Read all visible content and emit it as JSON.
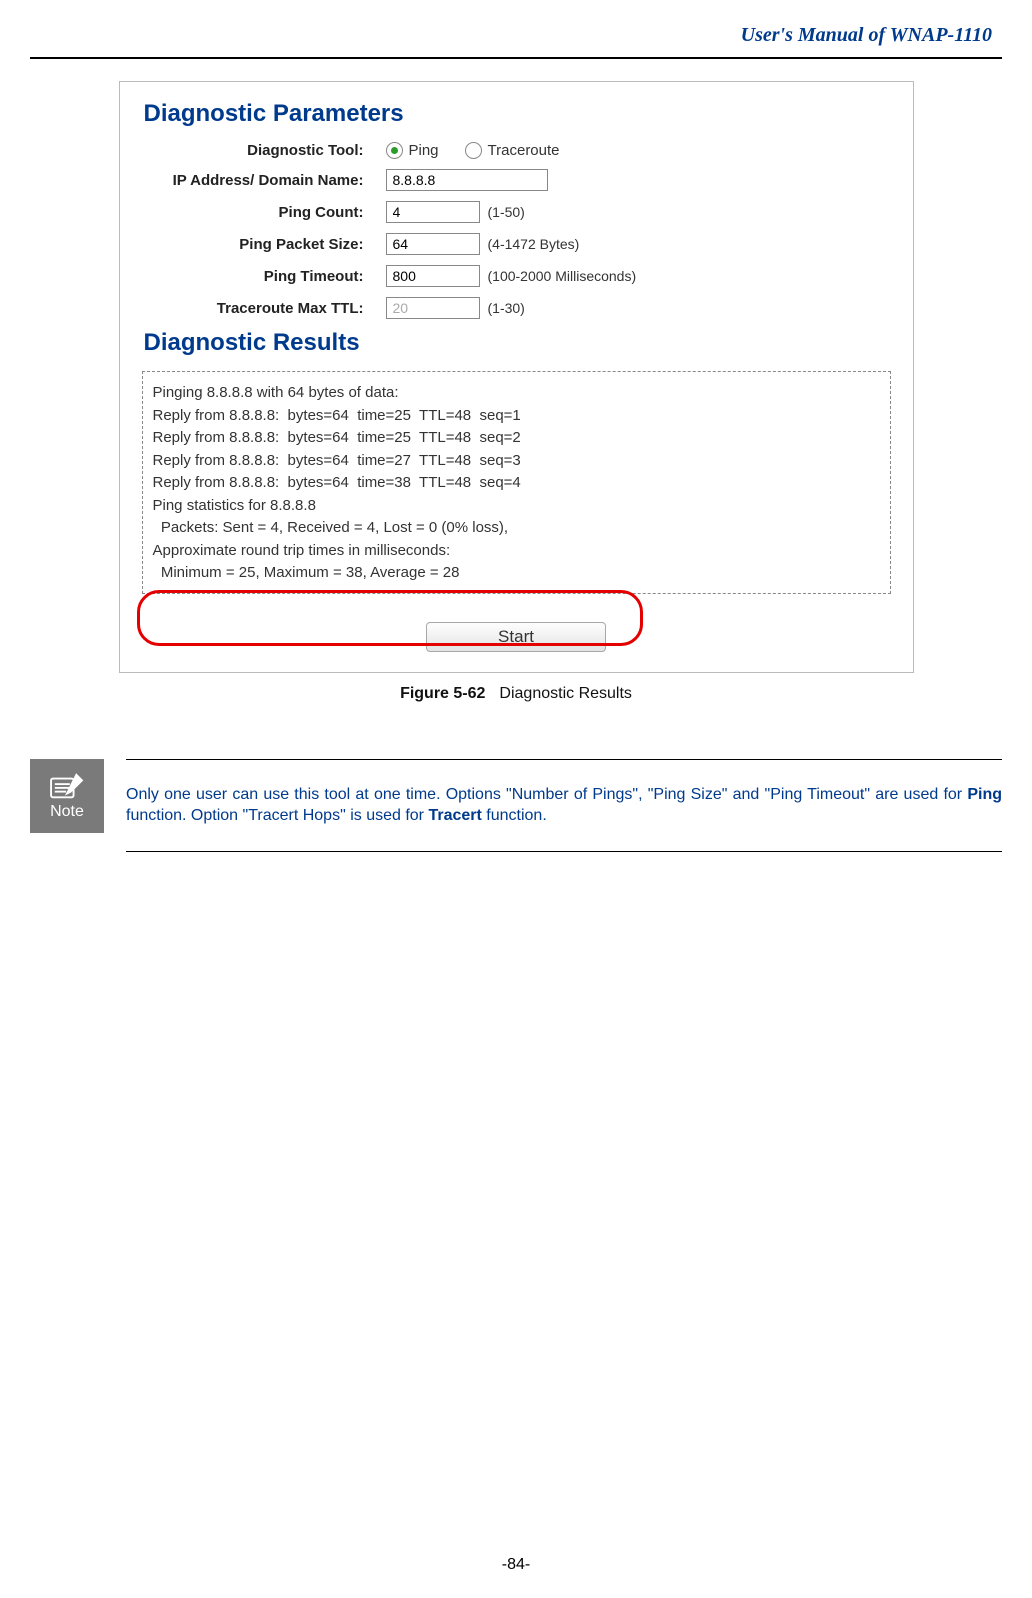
{
  "header": {
    "title": "User's Manual of WNAP-1110"
  },
  "panel": {
    "paramsTitle": "Diagnostic Parameters",
    "resultsTitle": "Diagnostic Results",
    "rows": {
      "tool": {
        "label": "Diagnostic Tool:",
        "options": {
          "ping": "Ping",
          "traceroute": "Traceroute"
        },
        "selected": "ping"
      },
      "ip": {
        "label": "IP Address/ Domain Name:",
        "value": "8.8.8.8"
      },
      "count": {
        "label": "Ping Count:",
        "value": "4",
        "hint": "(1-50)"
      },
      "size": {
        "label": "Ping Packet Size:",
        "value": "64",
        "hint": "(4-1472 Bytes)"
      },
      "timeout": {
        "label": "Ping Timeout:",
        "value": "800",
        "hint": "(100-2000 Milliseconds)"
      },
      "ttl": {
        "label": "Traceroute Max TTL:",
        "value": "20",
        "hint": "(1-30)"
      }
    },
    "results": {
      "l1": "Pinging 8.8.8.8 with 64 bytes of data:",
      "l2": "",
      "l3": "Reply from 8.8.8.8:  bytes=64  time=25  TTL=48  seq=1",
      "l4": "Reply from 8.8.8.8:  bytes=64  time=25  TTL=48  seq=2",
      "l5": "Reply from 8.8.8.8:  bytes=64  time=27  TTL=48  seq=3",
      "l6": "Reply from 8.8.8.8:  bytes=64  time=38  TTL=48  seq=4",
      "l7": "",
      "l8": "Ping statistics for 8.8.8.8",
      "l9": "  Packets: Sent = 4, Received = 4, Lost = 0 (0% loss),",
      "l10": "Approximate round trip times in milliseconds:",
      "l11": "  Minimum = 25, Maximum = 38, Average = 28"
    },
    "startButton": "Start"
  },
  "caption": {
    "figNum": "Figure 5-62",
    "text": "Diagnostic Results"
  },
  "note": {
    "label": "Note",
    "pre1": "Only one user can use this tool at one time. Options \"Number of Pings\", \"Ping Size\" and \"Ping Timeout\" are used for ",
    "bold1": "Ping",
    "mid1": " function. Option \"Tracert Hops\" is used for ",
    "bold2": "Tracert",
    "post1": " function."
  },
  "pageNumber": "-84-"
}
